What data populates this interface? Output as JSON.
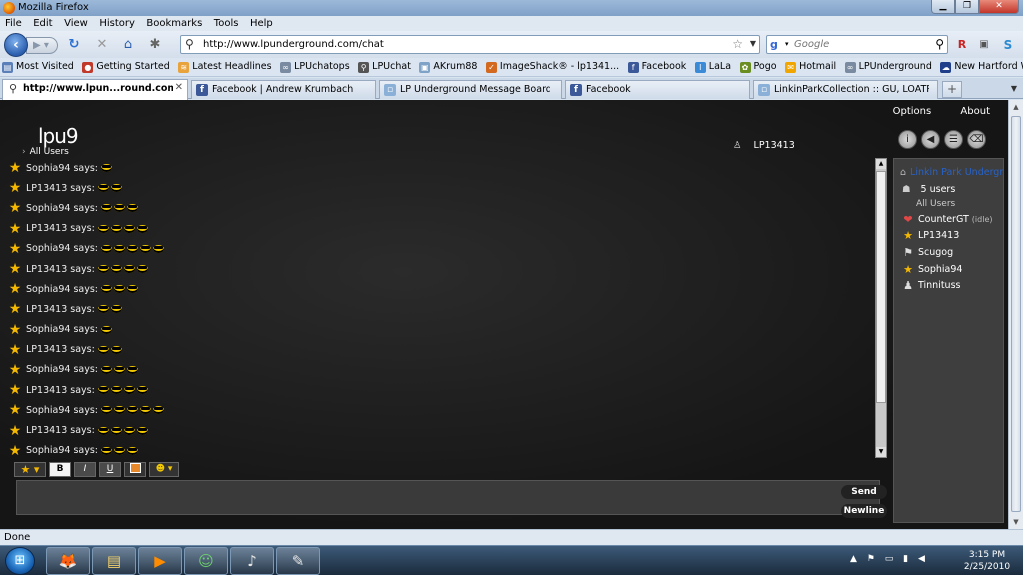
{
  "window": {
    "title": "Mozilla Firefox"
  },
  "menu": [
    "File",
    "Edit",
    "View",
    "History",
    "Bookmarks",
    "Tools",
    "Help"
  ],
  "nav": {
    "url": "http://www.lpunderground.com/chat",
    "search_placeholder": "Google"
  },
  "bookmarks": [
    "Most Visited",
    "Getting Started",
    "Latest Headlines",
    "LPUchatops",
    "LPUchat",
    "AKrum88",
    "ImageShack® - lp1341...",
    "Facebook",
    "LaLa",
    "Pogo",
    "Hotmail",
    "LPUnderground",
    "New Hartford Weather"
  ],
  "tabs": [
    "http://www.lpun...round.com/chat",
    "Facebook | Andrew Krumbach",
    "LP Underground Message Board - P...",
    "Facebook",
    "LinkinParkCollection :: GU, LOATR a..."
  ],
  "app": {
    "logo": "lpu9",
    "menu_options": "Options",
    "menu_about": "About",
    "all_users": "All Users",
    "current_user": "LP13413",
    "send_label": "Send",
    "newline_label": "Newline",
    "messages": [
      {
        "user": "Sophia94 says:",
        "emoticons": 1
      },
      {
        "user": "LP13413 says:",
        "emoticons": 2
      },
      {
        "user": "Sophia94 says:",
        "emoticons": 3
      },
      {
        "user": "LP13413 says:",
        "emoticons": 4
      },
      {
        "user": "Sophia94 says:",
        "emoticons": 5
      },
      {
        "user": "LP13413 says:",
        "emoticons": 4
      },
      {
        "user": "Sophia94 says:",
        "emoticons": 3
      },
      {
        "user": "LP13413 says:",
        "emoticons": 2
      },
      {
        "user": "Sophia94 says:",
        "emoticons": 1
      },
      {
        "user": "LP13413 says:",
        "emoticons": 2
      },
      {
        "user": "Sophia94 says:",
        "emoticons": 3
      },
      {
        "user": "LP13413 says:",
        "emoticons": 4
      },
      {
        "user": "Sophia94 says:",
        "emoticons": 5
      },
      {
        "user": "LP13413 says:",
        "emoticons": 4
      },
      {
        "user": "Sophia94 says:",
        "emoticons": 3
      }
    ],
    "room_name": "Linkin Park Undergr",
    "user_count": "5 users",
    "user_list_all": "All Users",
    "users": [
      {
        "name": "CounterGT",
        "status": "(idle)",
        "icon": "broken-heart-icon"
      },
      {
        "name": "LP13413",
        "status": "",
        "icon": "star-icon"
      },
      {
        "name": "Scugog",
        "status": "",
        "icon": "flag-icon"
      },
      {
        "name": "Sophia94",
        "status": "",
        "icon": "star-icon"
      },
      {
        "name": "Tinnituss",
        "status": "",
        "icon": "group-icon"
      }
    ]
  },
  "status": "Done",
  "clock": {
    "time": "3:15 PM",
    "date": "2/25/2010"
  }
}
